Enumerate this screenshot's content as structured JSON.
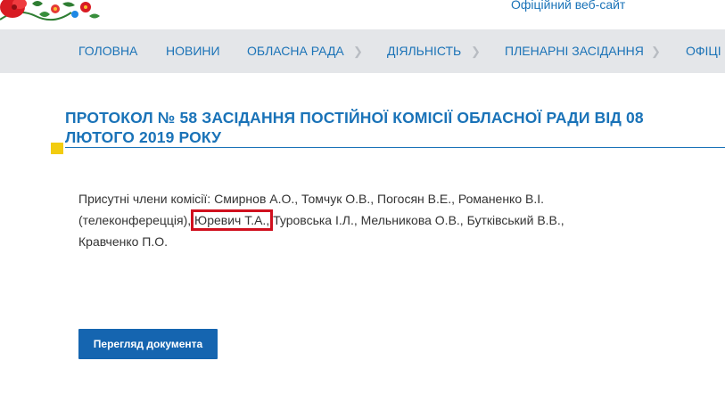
{
  "header": {
    "site_tag": "Офіційний веб-сайт"
  },
  "nav": {
    "items": [
      {
        "label": "Головна"
      },
      {
        "label": "Новини"
      },
      {
        "label": "Обласна рада"
      },
      {
        "label": "Діяльність"
      },
      {
        "label": "Пленарні засідання"
      },
      {
        "label": "Офіці"
      }
    ]
  },
  "article": {
    "title": "ПРОТОКОЛ № 58 ЗАСІДАННЯ ПОСТІЙНОЇ КОМІСІЇ ОБЛАСНОЇ РАДИ ВІД 08 ЛЮТОГО 2019 РОКУ",
    "members_prefix": "Присутні члени комісії: Смирнов А.О., Томчук О.В., Погосян В.Е., Романенко В.І.(телеконферецція),",
    "members_highlight": "Юревич Т.А.,",
    "members_suffix": "Туровська І.Л., Мельникова О.В., Бутківський В.В., Кравченко П.О.",
    "view_button": "Перегляд документа"
  },
  "colors": {
    "accent": "#1a73b8",
    "nav_bg": "#e4e6e9",
    "button_bg": "#1565b0",
    "highlight_border": "#d0101e",
    "marker": "#f2cc10"
  },
  "icons": {
    "logo": "floral-ornament-icon",
    "nav_separator": "chevron-right-icon"
  }
}
